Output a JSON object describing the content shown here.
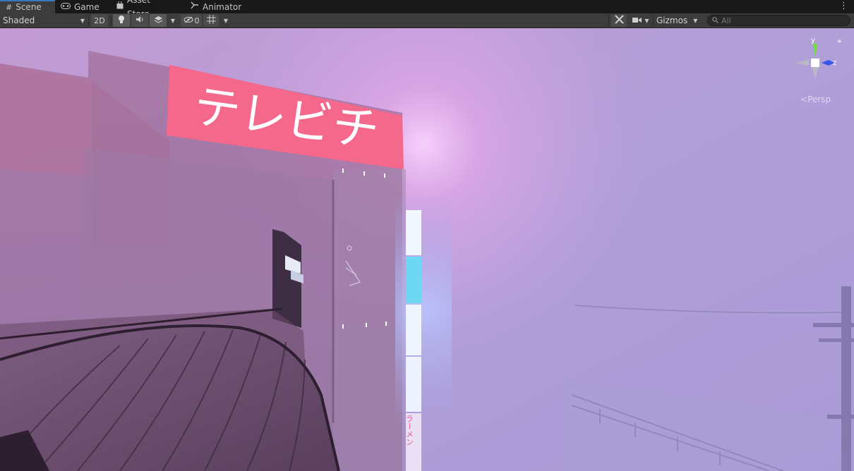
{
  "tabs": [
    {
      "label": "Scene",
      "icon": "grid-icon",
      "active": true
    },
    {
      "label": "Game",
      "icon": "gamepad-icon",
      "active": false
    },
    {
      "label": "Asset Store",
      "icon": "bag-icon",
      "active": false
    },
    {
      "label": "Animator",
      "icon": "animator-icon",
      "active": false
    }
  ],
  "toolbar": {
    "draw_mode": "Shaded",
    "mode_2d": "2D",
    "hidden_count": "0",
    "gizmos_label": "Gizmos",
    "search_placeholder": "All"
  },
  "scene": {
    "sign_text": "テレビチ",
    "vertical_sign_text": "ラーメン",
    "projection_label": "Persp",
    "axis_labels": {
      "y": "y",
      "z": "z"
    }
  }
}
